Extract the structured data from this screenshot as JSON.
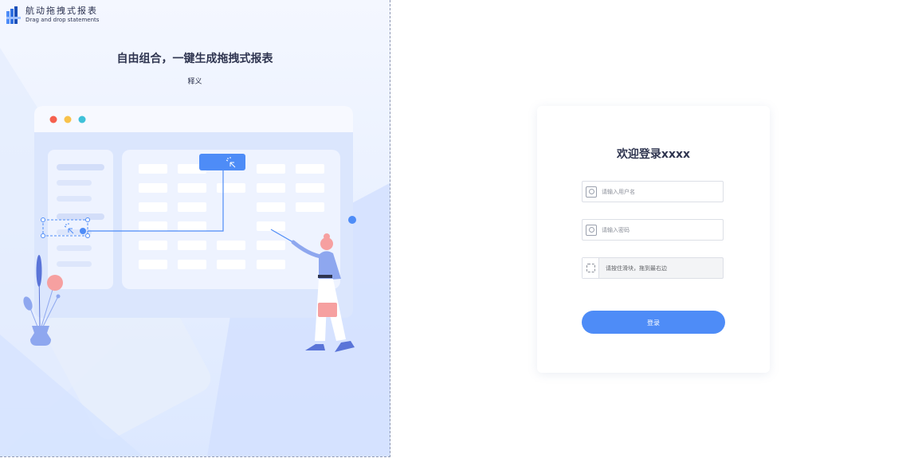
{
  "brand": {
    "name_cn": "航动拖拽式报表",
    "name_en": "Drag and drop statements"
  },
  "hero": {
    "headline": "自由组合，一键生成拖拽式报表",
    "subline": "释义"
  },
  "login": {
    "title": "欢迎登录xxxx",
    "username": {
      "placeholder": "请输入用户名",
      "value": ""
    },
    "password": {
      "placeholder": "请输入密码",
      "value": ""
    },
    "slider_text": "请按住滑块，拖到最右边",
    "submit_label": "登录"
  },
  "colors": {
    "accent": "#4e8cf7",
    "title_text": "#2f3550",
    "traffic_red": "#f5604e",
    "traffic_yellow": "#f8c24b",
    "traffic_teal": "#3fc1d9",
    "illustration_pink": "#f6a0a0"
  },
  "icons": {
    "logo": "bar-logo-icon",
    "username": "user-icon",
    "password": "lock-icon",
    "slider_handle": "drag-handle-icon",
    "cursor": "click-cursor-icon"
  }
}
